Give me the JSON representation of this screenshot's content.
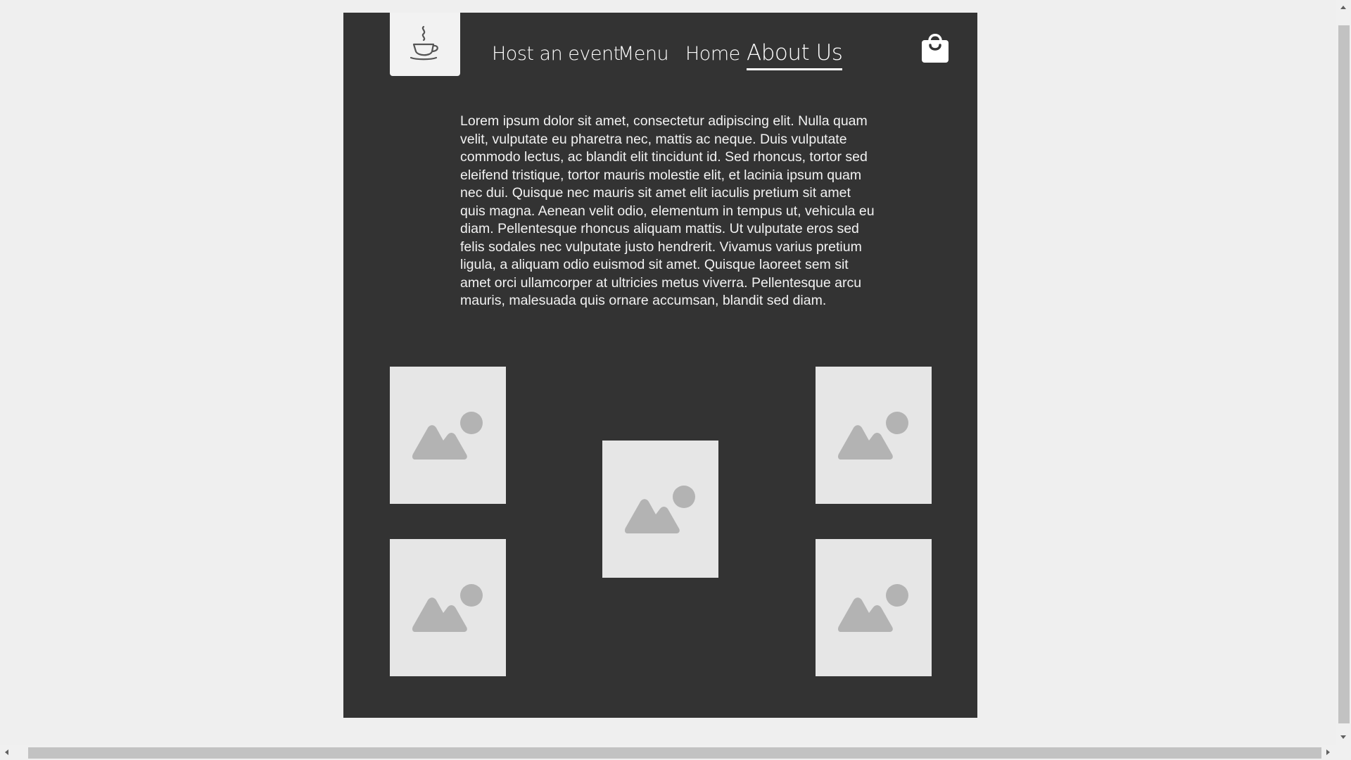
{
  "nav": {
    "logo_icon": "coffee-cup-icon",
    "items": [
      {
        "label": "Host an event"
      },
      {
        "label": "Menu"
      },
      {
        "label": "Home"
      },
      {
        "label": "About Us",
        "active": true
      }
    ],
    "cart_icon": "shopping-bag-icon"
  },
  "about": {
    "text": "Lorem ipsum dolor sit amet, consectetur adipiscing elit. Nulla quam velit, vulputate eu pharetra nec, mattis ac neque. Duis vulputate commodo lectus, ac blandit elit tincidunt id. Sed rhoncus, tortor sed eleifend tristique, tortor mauris molestie elit, et lacinia ipsum quam nec dui. Quisque nec mauris sit amet elit iaculis pretium sit amet quis magna. Aenean velit odio, elementum in tempus ut, vehicula eu diam. Pellentesque rhoncus aliquam mattis. Ut vulputate eros sed felis sodales nec vulputate justo hendrerit. Vivamus varius pretium ligula, a aliquam odio euismod sit amet. Quisque laoreet sem sit amet orci ullamcorper at ultricies metus viverra. Pellentesque arcu mauris, malesuada quis ornare accumsan, blandit sed diam."
  },
  "gallery": {
    "image_icon": "image-placeholder-icon",
    "count": 5
  },
  "colors": {
    "page_background": "#efefef",
    "panel_background": "#333333",
    "placeholder_background": "#e6e6e6",
    "placeholder_icon": "#b3b3b3",
    "text": "#ffffff"
  }
}
